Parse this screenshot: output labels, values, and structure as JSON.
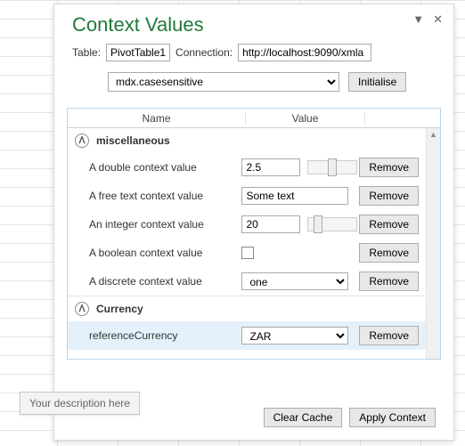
{
  "title": "Context Values",
  "labels": {
    "table": "Table:",
    "connection": "Connection:"
  },
  "inputs": {
    "table": "PivotTable1",
    "connection": "http://localhost:9090/xmla",
    "property_select": "mdx.casesensitive"
  },
  "buttons": {
    "initialise": "Initialise",
    "remove": "Remove",
    "clear_cache": "Clear Cache",
    "apply_context": "Apply Context"
  },
  "columns": {
    "name": "Name",
    "value": "Value"
  },
  "groups": {
    "misc": "miscellaneous",
    "currency": "Currency"
  },
  "rows": {
    "r0": {
      "name": "A double context value",
      "value": "2.5"
    },
    "r1": {
      "name": "A free text context value",
      "value": "Some text"
    },
    "r2": {
      "name": "An integer context value",
      "value": "20"
    },
    "r3": {
      "name": "A boolean context value"
    },
    "r4": {
      "name": "A discrete context value",
      "value": "one"
    },
    "r5": {
      "name": "referenceCurrency",
      "value": "ZAR"
    }
  },
  "tooltip": "Your description here"
}
